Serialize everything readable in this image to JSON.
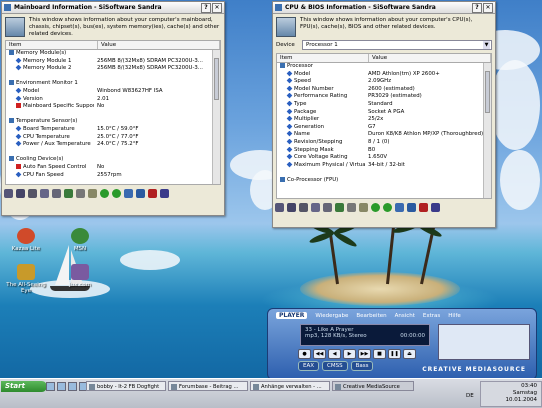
{
  "mainboard_window": {
    "title": "Mainboard Information - SiSoftware Sandra",
    "description": "This window shows information about your computer's mainboard, chassis, chipset(s), bus(es), system memory(ies), cache(s) and other related devices.",
    "col_item": "Item",
    "col_value": "Value",
    "rows": [
      {
        "item": "Memory Module(s)",
        "value": "",
        "level": 0,
        "icon": "memory-icon",
        "color": "#3a6fb0"
      },
      {
        "item": "Memory Module 1",
        "value": "256MB 8/(32Mx8) SDRAM PC3200U-3...",
        "level": 1,
        "icon": "diamond-icon",
        "color": "#2a5fc0"
      },
      {
        "item": "Memory Module 2",
        "value": "256MB 8/(32Mx8) SDRAM PC3200U-3...",
        "level": 1,
        "icon": "diamond-icon",
        "color": "#2a5fc0"
      },
      {
        "item": "",
        "value": "",
        "level": 0,
        "icon": "",
        "color": ""
      },
      {
        "item": "Environment Monitor 1",
        "value": "",
        "level": 0,
        "icon": "monitor-icon",
        "color": "#3a6fb0"
      },
      {
        "item": "Model",
        "value": "Winbond W83627HF ISA",
        "level": 1,
        "icon": "diamond-icon",
        "color": "#2a5fc0"
      },
      {
        "item": "Version",
        "value": "2.01",
        "level": 1,
        "icon": "diamond-icon",
        "color": "#2a5fc0"
      },
      {
        "item": "Mainboard Specific Support",
        "value": "No",
        "level": 1,
        "icon": "x-icon",
        "color": "#d02020"
      },
      {
        "item": "",
        "value": "",
        "level": 0,
        "icon": "",
        "color": ""
      },
      {
        "item": "Temperature Sensor(s)",
        "value": "",
        "level": 0,
        "icon": "thermometer-icon",
        "color": "#3a6fb0"
      },
      {
        "item": "Board Temperature",
        "value": "15.0°C / 59.0°F",
        "level": 1,
        "icon": "diamond-icon",
        "color": "#2a5fc0"
      },
      {
        "item": "CPU Temperature",
        "value": "25.0°C / 77.0°F",
        "level": 1,
        "icon": "diamond-icon",
        "color": "#2a5fc0"
      },
      {
        "item": "Power / Aux Temperature",
        "value": "24.0°C / 75.2°F",
        "level": 1,
        "icon": "diamond-icon",
        "color": "#2a5fc0"
      },
      {
        "item": "",
        "value": "",
        "level": 0,
        "icon": "",
        "color": ""
      },
      {
        "item": "Cooling Device(s)",
        "value": "",
        "level": 0,
        "icon": "fan-icon",
        "color": "#3a6fb0"
      },
      {
        "item": "Auto Fan Speed Control",
        "value": "No",
        "level": 1,
        "icon": "x-icon",
        "color": "#d02020"
      },
      {
        "item": "CPU Fan Speed",
        "value": "2557rpm",
        "level": 1,
        "icon": "diamond-icon",
        "color": "#2a5fc0"
      }
    ]
  },
  "cpu_window": {
    "title": "CPU & BIOS Information - SiSoftware Sandra",
    "description": "This window shows information about your computer's CPU(s), FPU(s), cache(s), BIOS and other related devices.",
    "device_label": "Device",
    "device_value": "Processor 1",
    "col_item": "Item",
    "col_value": "Value",
    "rows": [
      {
        "item": "Processor",
        "value": "",
        "level": 0,
        "icon": "cpu-icon",
        "color": "#3a6fb0"
      },
      {
        "item": "Model",
        "value": "AMD Athlon(tm) XP 2600+",
        "level": 1,
        "icon": "diamond-icon",
        "color": "#2a5fc0"
      },
      {
        "item": "Speed",
        "value": "2.09GHz",
        "level": 1,
        "icon": "diamond-icon",
        "color": "#2a5fc0"
      },
      {
        "item": "Model Number",
        "value": "2600 (estimated)",
        "level": 1,
        "icon": "diamond-icon",
        "color": "#2a5fc0"
      },
      {
        "item": "Performance Rating",
        "value": "PR3029 (estimated)",
        "level": 1,
        "icon": "diamond-icon",
        "color": "#2a5fc0"
      },
      {
        "item": "Type",
        "value": "Standard",
        "level": 1,
        "icon": "diamond-icon",
        "color": "#2a5fc0"
      },
      {
        "item": "Package",
        "value": "Socket A PGA",
        "level": 1,
        "icon": "diamond-icon",
        "color": "#2a5fc0"
      },
      {
        "item": "Multiplier",
        "value": "25/2x",
        "level": 1,
        "icon": "diamond-icon",
        "color": "#2a5fc0"
      },
      {
        "item": "Generation",
        "value": "G7",
        "level": 1,
        "icon": "diamond-icon",
        "color": "#2a5fc0"
      },
      {
        "item": "Name",
        "value": "Duron K8/K8 Athlon MP/XP (Thoroughbred) ...",
        "level": 1,
        "icon": "diamond-icon",
        "color": "#2a5fc0"
      },
      {
        "item": "Revision/Stepping",
        "value": "8 / 1 (0)",
        "level": 1,
        "icon": "diamond-icon",
        "color": "#2a5fc0"
      },
      {
        "item": "Stepping Mask",
        "value": "B0",
        "level": 1,
        "icon": "diamond-icon",
        "color": "#2a5fc0"
      },
      {
        "item": "Core Voltage Rating",
        "value": "1.650V",
        "level": 1,
        "icon": "diamond-icon",
        "color": "#2a5fc0"
      },
      {
        "item": "Maximum Physical / Virtual Ad...",
        "value": "34-bit / 32-bit",
        "level": 1,
        "icon": "diamond-icon",
        "color": "#2a5fc0"
      },
      {
        "item": "",
        "value": "",
        "level": 0,
        "icon": "",
        "color": ""
      },
      {
        "item": "Co-Processor (FPU)",
        "value": "",
        "level": 0,
        "icon": "fpu-icon",
        "color": "#3a6fb0"
      }
    ]
  },
  "desktop_icons": [
    {
      "label": "Kazaa Lite",
      "icon": "kazaa-icon",
      "color": "#d04a2a"
    },
    {
      "label": "MSN",
      "icon": "msn-icon",
      "color": "#3a8a3a"
    },
    {
      "label": "The All-Seeing Eye",
      "icon": "eye-icon",
      "color": "#c89a2a"
    },
    {
      "label": "Jux.com",
      "icon": "jux-icon",
      "color": "#7a5aa0"
    }
  ],
  "player": {
    "mode": "PLAYER",
    "menu": [
      "Wiedergabe",
      "Bearbeiten",
      "Ansicht",
      "Extras",
      "Hilfe"
    ],
    "track": "33 - Like A Prayer",
    "track_info": "mp3, 128 KB/s, Stereo",
    "time": "00:00:00",
    "bottom_buttons": [
      "EAX",
      "CMSS",
      "Bass"
    ],
    "brand": "CREATIVE MEDIASOURCE"
  },
  "taskbar": {
    "start_label": "Start",
    "tasks": [
      {
        "label": "bobby - It-2 FB Dogfight"
      },
      {
        "label": "Forumbase - Beitrag ..."
      },
      {
        "label": "Anhänge verwalten - ..."
      },
      {
        "label": "Creative MediaSource"
      }
    ],
    "time": "03:40",
    "day": "Samstag",
    "date": "10.01.2004",
    "lang": "DE"
  }
}
